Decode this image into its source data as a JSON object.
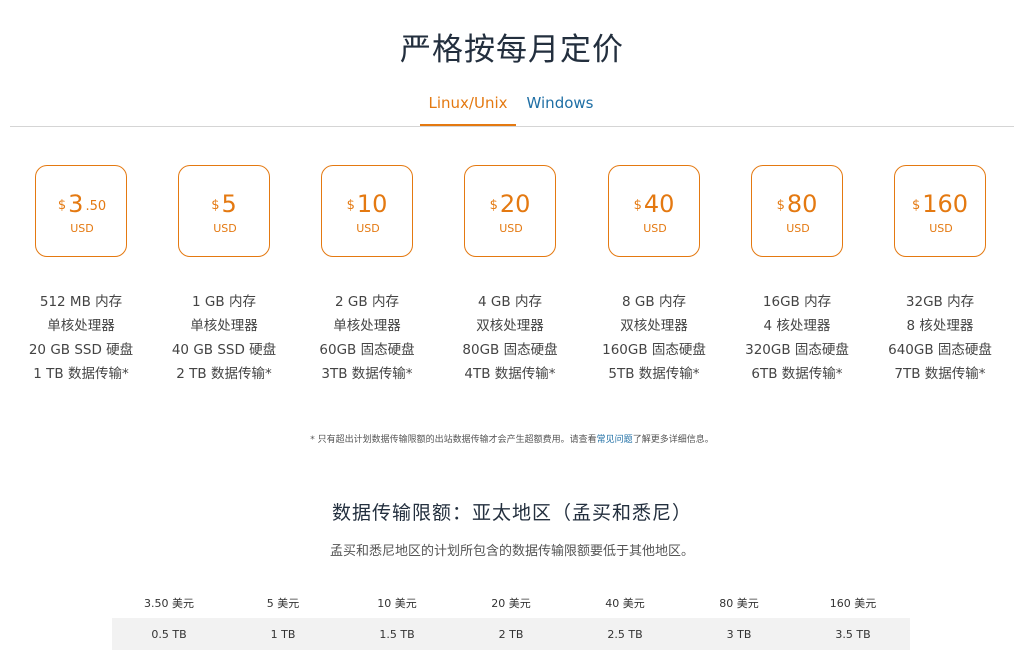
{
  "title": "严格按每月定价",
  "tabs": {
    "linux": "Linux/Unix",
    "windows": "Windows"
  },
  "colors": {
    "accent": "#e47911",
    "link": "#1f6fa5",
    "title": "#232f3e"
  },
  "plans": [
    {
      "dollar": "$",
      "amount": "3",
      "cents": ".50",
      "currency": "USD",
      "specs": [
        "512 MB 内存",
        "单核处理器",
        "20 GB SSD 硬盘",
        "1 TB 数据传输*"
      ]
    },
    {
      "dollar": "$",
      "amount": "5",
      "cents": "",
      "currency": "USD",
      "specs": [
        "1 GB 内存",
        "单核处理器",
        "40 GB SSD 硬盘",
        "2 TB 数据传输*"
      ]
    },
    {
      "dollar": "$",
      "amount": "10",
      "cents": "",
      "currency": "USD",
      "specs": [
        "2 GB 内存",
        "单核处理器",
        "60GB 固态硬盘",
        "3TB 数据传输*"
      ]
    },
    {
      "dollar": "$",
      "amount": "20",
      "cents": "",
      "currency": "USD",
      "specs": [
        "4 GB 内存",
        "双核处理器",
        "80GB 固态硬盘",
        "4TB 数据传输*"
      ]
    },
    {
      "dollar": "$",
      "amount": "40",
      "cents": "",
      "currency": "USD",
      "specs": [
        "8 GB 内存",
        "双核处理器",
        "160GB 固态硬盘",
        "5TB 数据传输*"
      ]
    },
    {
      "dollar": "$",
      "amount": "80",
      "cents": "",
      "currency": "USD",
      "specs": [
        "16GB 内存",
        "4 核处理器",
        "320GB 固态硬盘",
        "6TB 数据传输*"
      ]
    },
    {
      "dollar": "$",
      "amount": "160",
      "cents": "",
      "currency": "USD",
      "specs": [
        "32GB 内存",
        "8 核处理器",
        "640GB 固态硬盘",
        "7TB 数据传输*"
      ]
    }
  ],
  "footnote": {
    "before": "* 只有超出计划数据传输限额的出站数据传输才会产生超额费用。请查看",
    "link": "常见问题",
    "after": "了解更多详细信息。"
  },
  "transfer": {
    "title": "数据传输限额：亚太地区（孟买和悉尼）",
    "subtitle": "孟买和悉尼地区的计划所包含的数据传输限额要低于其他地区。",
    "headers": [
      "3.50 美元",
      "5 美元",
      "10 美元",
      "20 美元",
      "40 美元",
      "80 美元",
      "160 美元"
    ],
    "values": [
      "0.5 TB",
      "1 TB",
      "1.5 TB",
      "2 TB",
      "2.5 TB",
      "3 TB",
      "3.5 TB"
    ]
  }
}
